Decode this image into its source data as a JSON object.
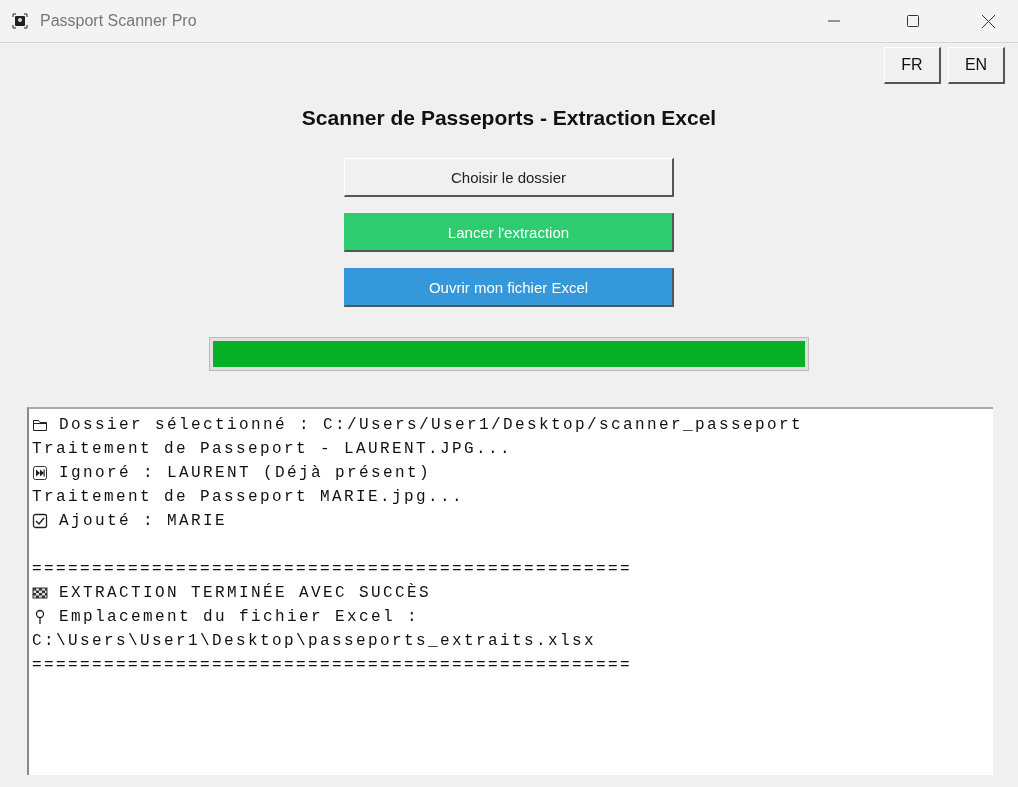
{
  "window": {
    "title": "Passport Scanner Pro"
  },
  "language_buttons": [
    {
      "label": "FR"
    },
    {
      "label": "EN"
    }
  ],
  "heading": "Scanner de Passeports - Extraction Excel",
  "actions": [
    {
      "label": "Choisir le dossier",
      "kind": "plain"
    },
    {
      "label": "Lancer l'extraction",
      "kind": "green"
    },
    {
      "label": "Ouvrir mon fichier Excel",
      "kind": "blue"
    }
  ],
  "progress": {
    "level": 1.0
  },
  "log": [
    {
      "kind": "folder",
      "text": "Dossier sélectionné : C:/Users/User1/Desktop/scanner_passeport"
    },
    {
      "kind": "text",
      "text": "Traitement de Passeport - LAURENT.JPG..."
    },
    {
      "kind": "skip",
      "text": "Ignoré : LAURENT (Déjà présent)"
    },
    {
      "kind": "text",
      "text": "Traitement de Passeport MARIE.jpg..."
    },
    {
      "kind": "check",
      "text": "Ajouté : MARIE"
    },
    {
      "kind": "blank"
    },
    {
      "kind": "text",
      "text": "=================================================="
    },
    {
      "kind": "flag",
      "text": "EXTRACTION TERMINÉE AVEC SUCCÈS"
    },
    {
      "kind": "pin",
      "text": "Emplacement du fichier Excel :"
    },
    {
      "kind": "text",
      "text": "C:\\Users\\User1\\Desktop\\passeports_extraits.xlsx"
    },
    {
      "kind": "text",
      "text": "=================================================="
    }
  ]
}
